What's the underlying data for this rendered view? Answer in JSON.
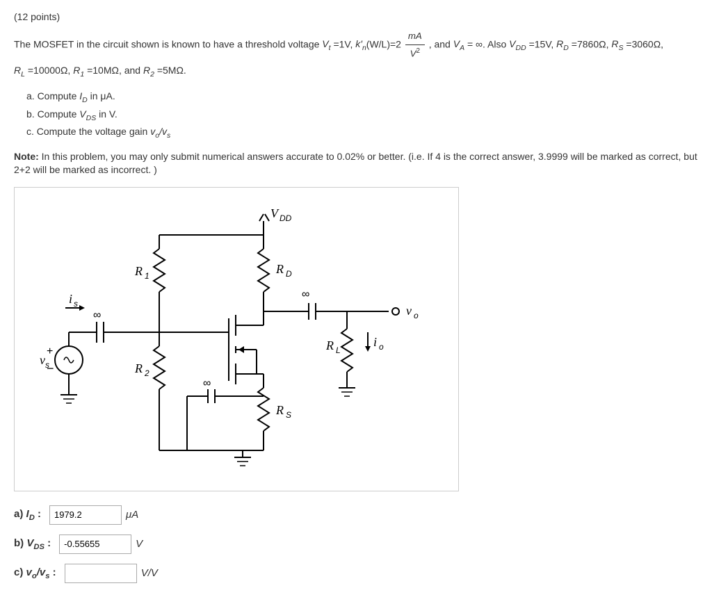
{
  "points": "(12 points)",
  "problem_line1_a": "The MOSFET in the circuit shown is known to have a threshold voltage ",
  "problem_line1_b": " =1V, ",
  "problem_line1_c": "(W/L)=2",
  "problem_line1_d": " , and ",
  "problem_line1_e": " = ∞. Also ",
  "problem_line1_f": " =15V, ",
  "problem_line1_g": " =7860Ω, ",
  "problem_line1_h": " =3060Ω,",
  "problem_line2_a": " =10000Ω, ",
  "problem_line2_b": " =10MΩ, and ",
  "problem_line2_c": " =5MΩ.",
  "q_a": "a.  Compute ",
  "q_a2": " in μA.",
  "q_b": "b.  Compute ",
  "q_b2": " in V.",
  "q_c": "c.  Compute the voltage gain ",
  "note_bold": "Note:",
  "note_text": " In this problem, you may only submit numerical answers accurate to 0.02% or better. (i.e. If 4 is the correct answer, 3.9999 will be marked as correct, but 2+2 will be marked as incorrect. )",
  "frac_num": "mA",
  "frac_den": "V",
  "circuit": {
    "vdd": "V",
    "vdd_sub": "DD",
    "rd": "R",
    "rd_sub": "D",
    "r1": "R",
    "r1_sub": "1",
    "r2": "R",
    "r2_sub": "2",
    "rs": "R",
    "rs_sub": "S",
    "rl": "R",
    "rl_sub": "L",
    "is": "i",
    "is_sub": "s",
    "io": "i",
    "io_sub": "o",
    "vs": "v",
    "vs_sub": "s",
    "vo": "v",
    "vo_sub": "o",
    "inf": "∞"
  },
  "answers": {
    "a_label": "a)",
    "a_sym": "I",
    "a_sub": "D",
    "a_value": "1979.2",
    "a_unit": "μA",
    "b_label": "b)",
    "b_sym": "V",
    "b_sub": "DS",
    "b_value": "-0.55655",
    "b_unit": "V",
    "c_label": "c)",
    "c_text": "v",
    "c_sub1": "o",
    "c_sep": "/",
    "c_text2": "v",
    "c_sub2": "s",
    "c_value": "",
    "c_unit": "V/V"
  }
}
